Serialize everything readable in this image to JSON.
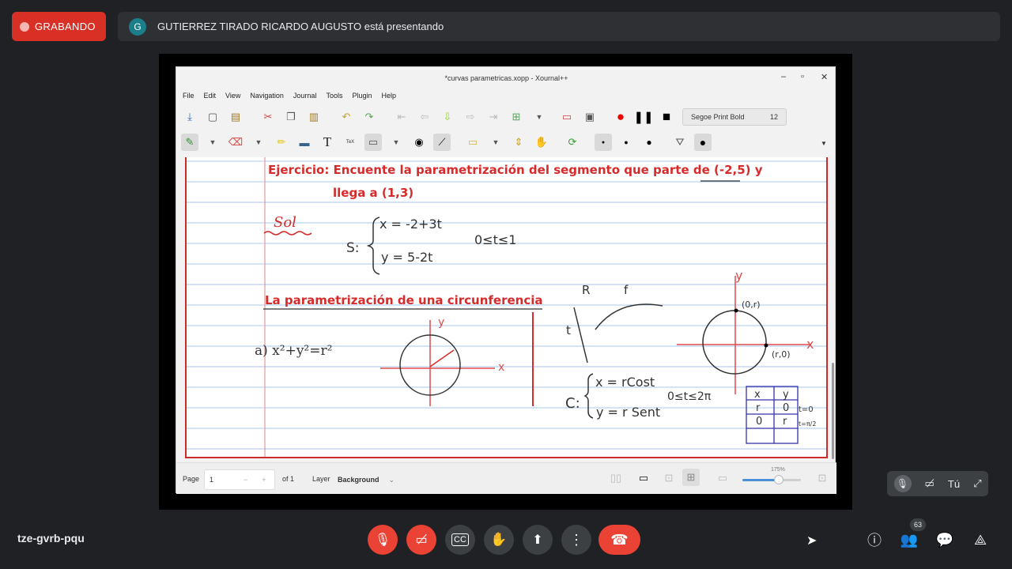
{
  "meet": {
    "recording_label": "GRABANDO",
    "presenter_initial": "G",
    "presenter_text": "GUTIERREZ TIRADO RICARDO AUGUSTO está presentando",
    "meeting_code": "tze-gvrb-pqu",
    "participants_count": "63",
    "self_label": "Tú"
  },
  "app": {
    "window_title": "*curvas parametricas.xopp - Xournal++",
    "menu": [
      "File",
      "Edit",
      "View",
      "Navigation",
      "Journal",
      "Tools",
      "Plugin",
      "Help"
    ],
    "font_name": "Segoe Print Bold",
    "font_size": "12",
    "status": {
      "page_label": "Page",
      "page_value": "1",
      "of_label": "of 1",
      "layer_label": "Layer",
      "layer_value": "Background",
      "zoom": "175%"
    }
  },
  "notes": {
    "exercise_line1": "Ejercicio: Encuente la parametrización del segmento que parte de (-2,5) y",
    "exercise_line2": "llega a (1,3)",
    "sol_mark": "Sol",
    "seg_label": "S:",
    "seg_eq1": "x = -2+3t",
    "seg_eq2": "y = 5-2t",
    "seg_range": "0≤t≤1",
    "circle_title": "La parametrización de una circunferencia",
    "eq_a": "a) x²+y²=r²",
    "axis_y": "y",
    "axis_x": "x",
    "map_R": "R",
    "map_f": "f",
    "map_t": "t",
    "c_label": "C:",
    "c_eq1": "x = rCost",
    "c_eq2": "y = r Sent",
    "c_range": "0≤t≤2π",
    "pt_top": "(0,r)",
    "pt_right": "(r,0)",
    "table": [
      [
        "x",
        "y"
      ],
      [
        "r",
        "0"
      ],
      [
        "0",
        "r"
      ]
    ],
    "t_note1": "t=0",
    "t_note2": "t=π/2"
  },
  "colors": {
    "red_ink": "#d62b2b",
    "page_lines": "#a9c9ec",
    "margin": "#e39a9a",
    "blue_ink": "#3333aa",
    "meet_red": "#ea4335"
  }
}
